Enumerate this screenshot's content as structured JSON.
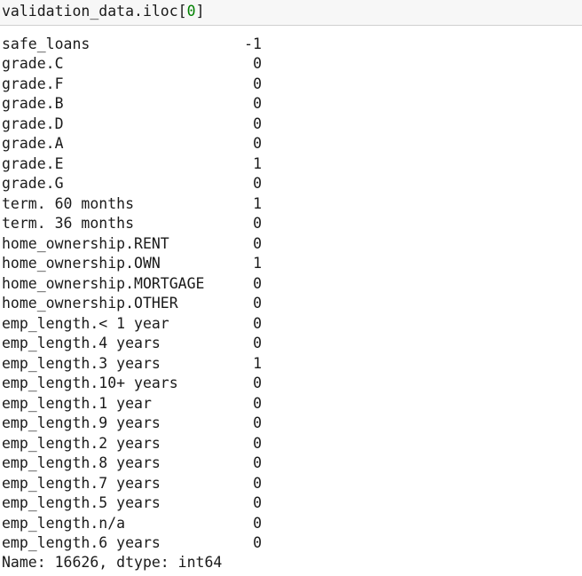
{
  "input_cell": {
    "code_prefix": "validation_data.iloc[",
    "code_index": "0",
    "code_suffix": "]"
  },
  "output": {
    "rows": [
      {
        "key": "safe_loans",
        "value": "-1"
      },
      {
        "key": "grade.C",
        "value": "0"
      },
      {
        "key": "grade.F",
        "value": "0"
      },
      {
        "key": "grade.B",
        "value": "0"
      },
      {
        "key": "grade.D",
        "value": "0"
      },
      {
        "key": "grade.A",
        "value": "0"
      },
      {
        "key": "grade.E",
        "value": "1"
      },
      {
        "key": "grade.G",
        "value": "0"
      },
      {
        "key": "term. 60 months",
        "value": "1"
      },
      {
        "key": "term. 36 months",
        "value": "0"
      },
      {
        "key": "home_ownership.RENT",
        "value": "0"
      },
      {
        "key": "home_ownership.OWN",
        "value": "1"
      },
      {
        "key": "home_ownership.MORTGAGE",
        "value": "0"
      },
      {
        "key": "home_ownership.OTHER",
        "value": "0"
      },
      {
        "key": "emp_length.< 1 year",
        "value": "0"
      },
      {
        "key": "emp_length.4 years",
        "value": "0"
      },
      {
        "key": "emp_length.3 years",
        "value": "1"
      },
      {
        "key": "emp_length.10+ years",
        "value": "0"
      },
      {
        "key": "emp_length.1 year",
        "value": "0"
      },
      {
        "key": "emp_length.9 years",
        "value": "0"
      },
      {
        "key": "emp_length.2 years",
        "value": "0"
      },
      {
        "key": "emp_length.8 years",
        "value": "0"
      },
      {
        "key": "emp_length.7 years",
        "value": "0"
      },
      {
        "key": "emp_length.5 years",
        "value": "0"
      },
      {
        "key": "emp_length.n/a",
        "value": "0"
      },
      {
        "key": "emp_length.6 years",
        "value": "0"
      }
    ],
    "footer": "Name: 16626, dtype: int64"
  },
  "colors": {
    "number_literal": "#008000",
    "input_background": "#f7f7f7"
  }
}
